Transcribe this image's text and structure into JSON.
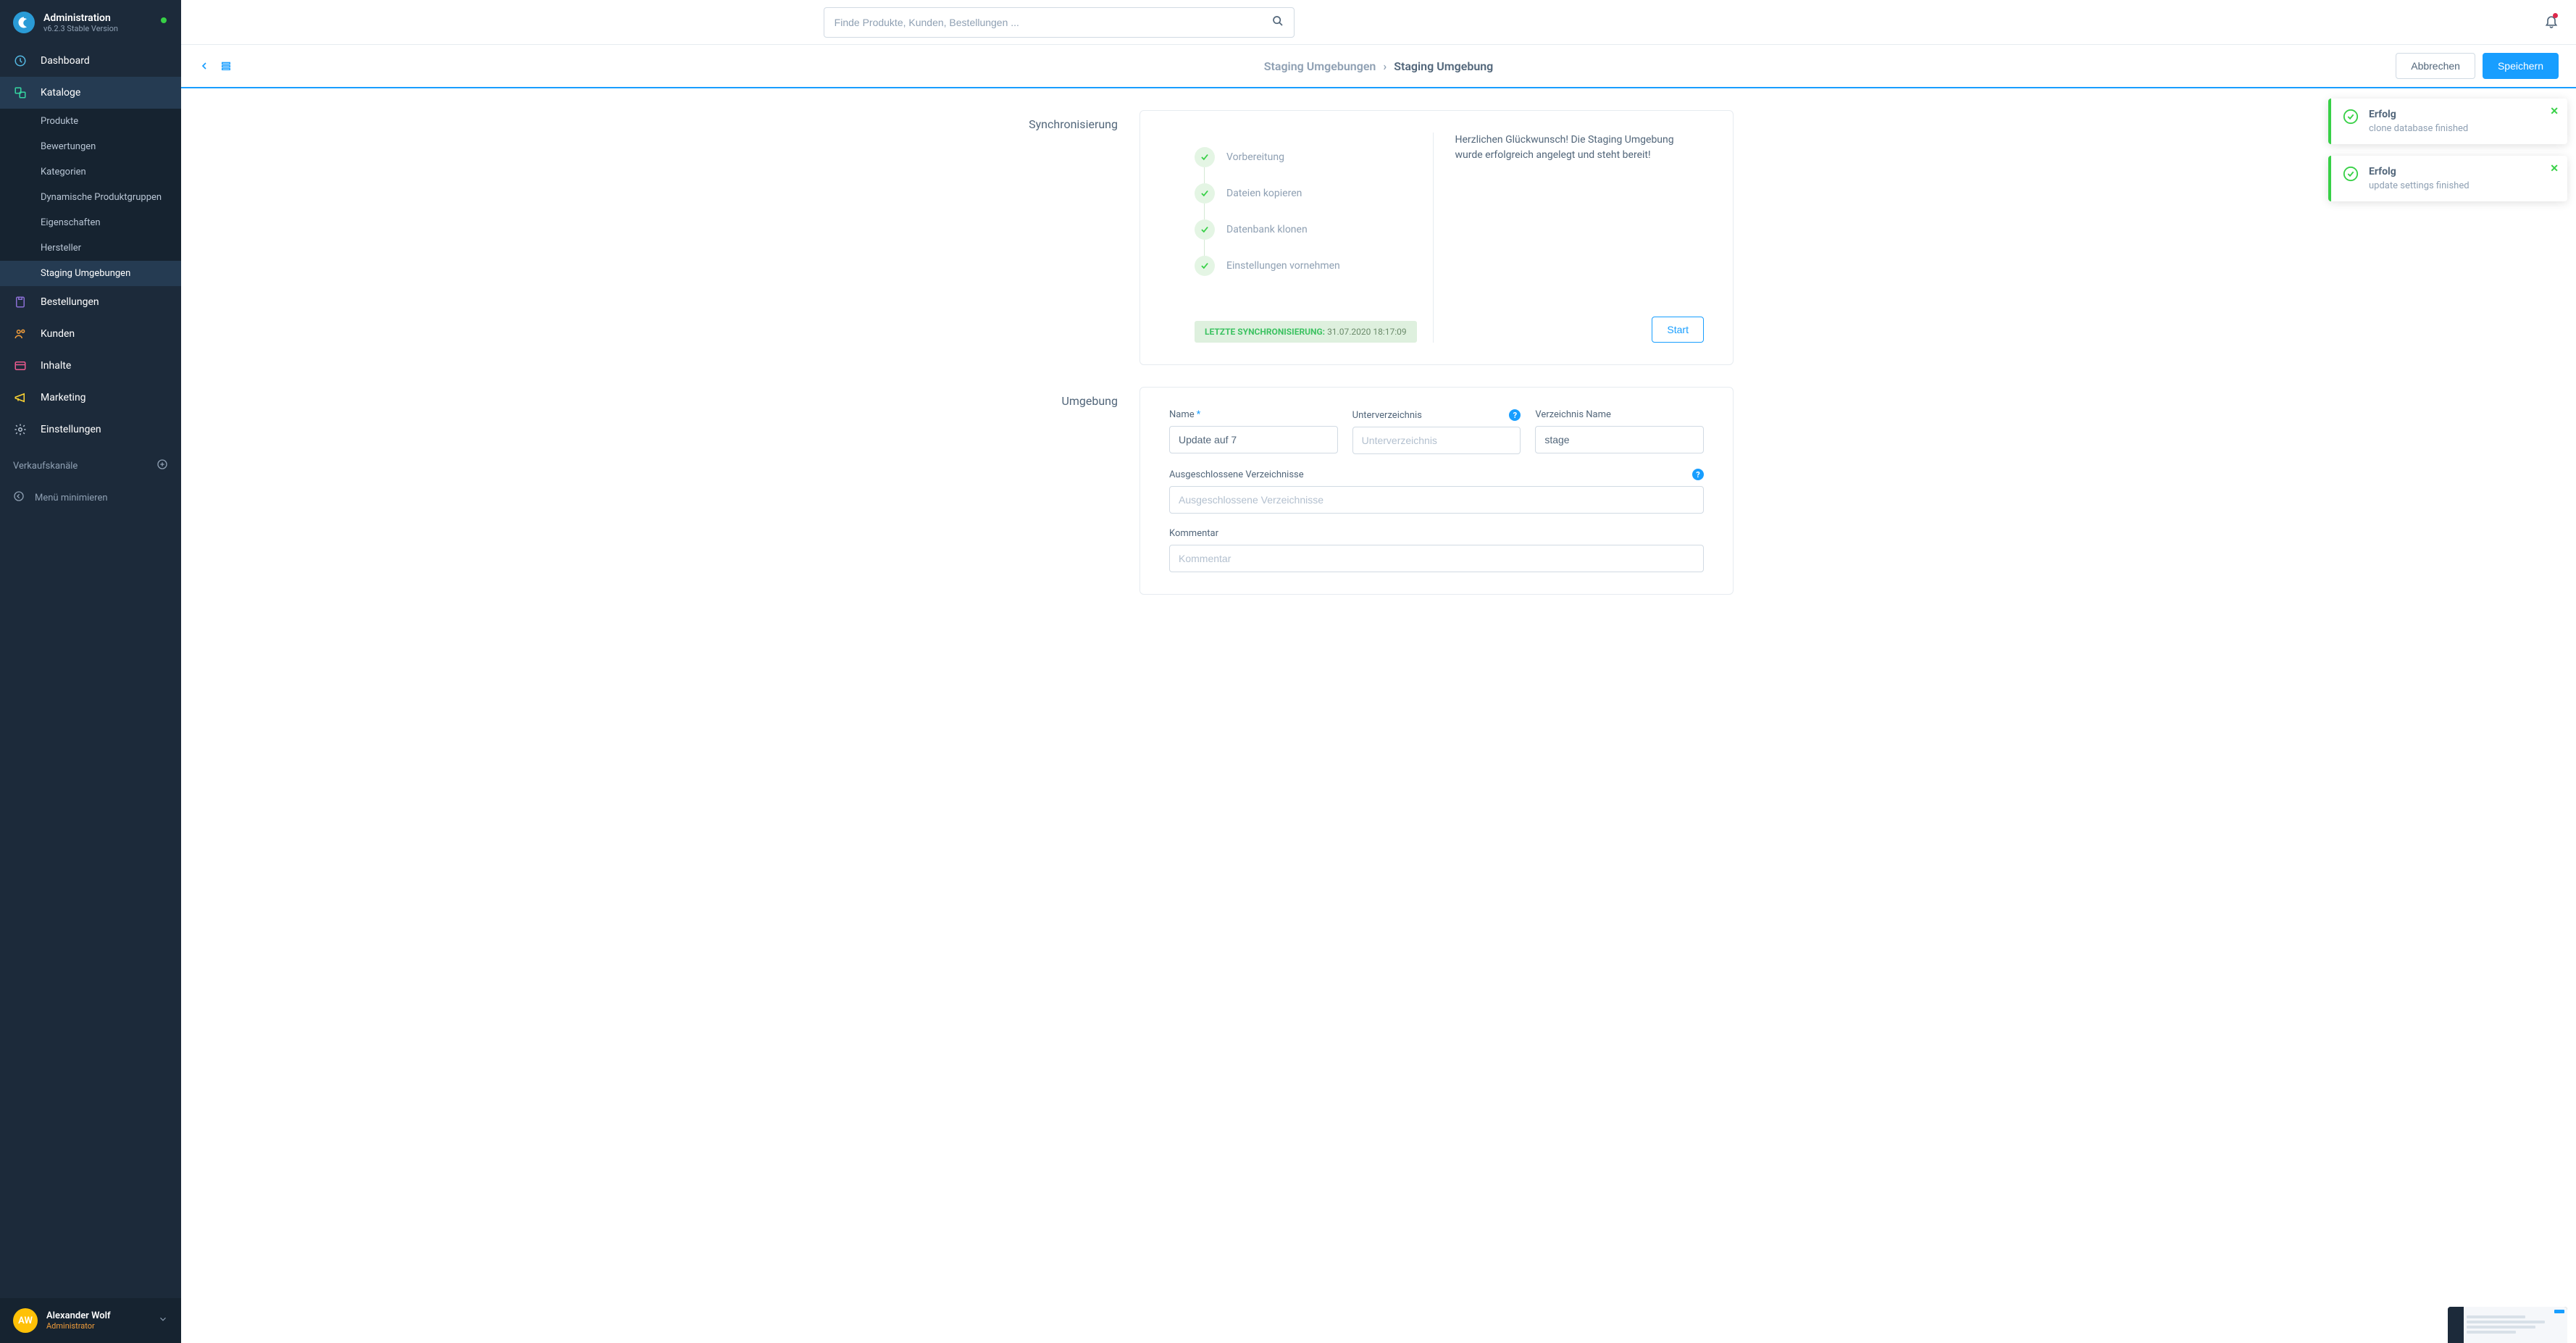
{
  "header": {
    "title": "Administration",
    "version": "v6.2.3 Stable Version"
  },
  "search": {
    "placeholder": "Finde Produkte, Kunden, Bestellungen ..."
  },
  "nav": {
    "dashboard": "Dashboard",
    "kataloge": "Kataloge",
    "bestellungen": "Bestellungen",
    "kunden": "Kunden",
    "inhalte": "Inhalte",
    "marketing": "Marketing",
    "einstellungen": "Einstellungen",
    "sub": {
      "produkte": "Produkte",
      "bewertungen": "Bewertungen",
      "kategorien": "Kategorien",
      "dynamische": "Dynamische Produktgruppen",
      "eigenschaften": "Eigenschaften",
      "hersteller": "Hersteller",
      "staging": "Staging Umgebungen"
    }
  },
  "channels_label": "Verkaufskanäle",
  "minimize_label": "Menü minimieren",
  "user": {
    "initials": "AW",
    "name": "Alexander Wolf",
    "role": "Administrator"
  },
  "breadcrumb": {
    "parent": "Staging Umgebungen",
    "current": "Staging Umgebung"
  },
  "actions": {
    "cancel": "Abbrechen",
    "save": "Speichern"
  },
  "sync": {
    "section_label": "Synchronisierung",
    "steps": {
      "s1": "Vorbereitung",
      "s2": "Dateien kopieren",
      "s3": "Datenbank klonen",
      "s4": "Einstellungen vornehmen"
    },
    "last_sync_label": "LETZTE SYNCHRONISIERUNG:",
    "last_sync_time": "31.07.2020 18:17:09",
    "congrats": "Herzlichen Glückwunsch! Die Staging Umgebung wurde erfolgreich angelegt und steht bereit!",
    "start": "Start"
  },
  "env": {
    "section_label": "Umgebung",
    "name_label": "Name",
    "name_value": "Update auf 7",
    "subdir_label": "Unterverzeichnis",
    "subdir_placeholder": "Unterverzeichnis",
    "dirname_label": "Verzeichnis Name",
    "dirname_value": "stage",
    "excluded_label": "Ausgeschlossene Verzeichnisse",
    "excluded_placeholder": "Ausgeschlossene Verzeichnisse",
    "comment_label": "Kommentar",
    "comment_placeholder": "Kommentar"
  },
  "toasts": {
    "t1_title": "Erfolg",
    "t1_msg": "clone database finished",
    "t2_title": "Erfolg",
    "t2_msg": "update settings finished"
  }
}
